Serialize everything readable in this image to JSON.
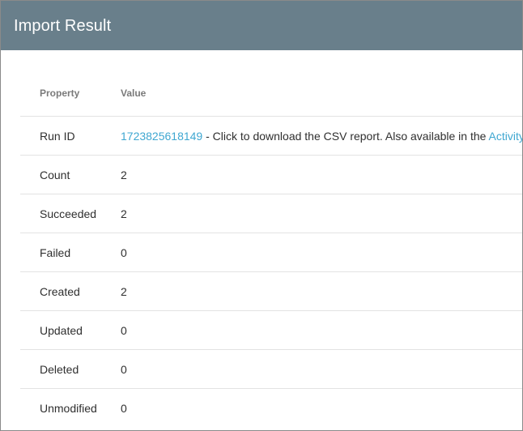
{
  "dialog": {
    "title": "Import Result"
  },
  "table": {
    "columns": {
      "property": "Property",
      "value": "Value"
    },
    "rows": [
      {
        "property": "Run ID",
        "run_id_link": "1723825618149",
        "text": " - Click to download the CSV report. Also available in the ",
        "activity_link": "Activity T"
      },
      {
        "property": "Count",
        "value": "2"
      },
      {
        "property": "Succeeded",
        "value": "2"
      },
      {
        "property": "Failed",
        "value": "0"
      },
      {
        "property": "Created",
        "value": "2"
      },
      {
        "property": "Updated",
        "value": "0"
      },
      {
        "property": "Deleted",
        "value": "0"
      },
      {
        "property": "Unmodified",
        "value": "0"
      }
    ]
  },
  "colors": {
    "header_bg": "#697f8b",
    "link": "#3fa7d1",
    "divider": "#e3e3e3"
  }
}
